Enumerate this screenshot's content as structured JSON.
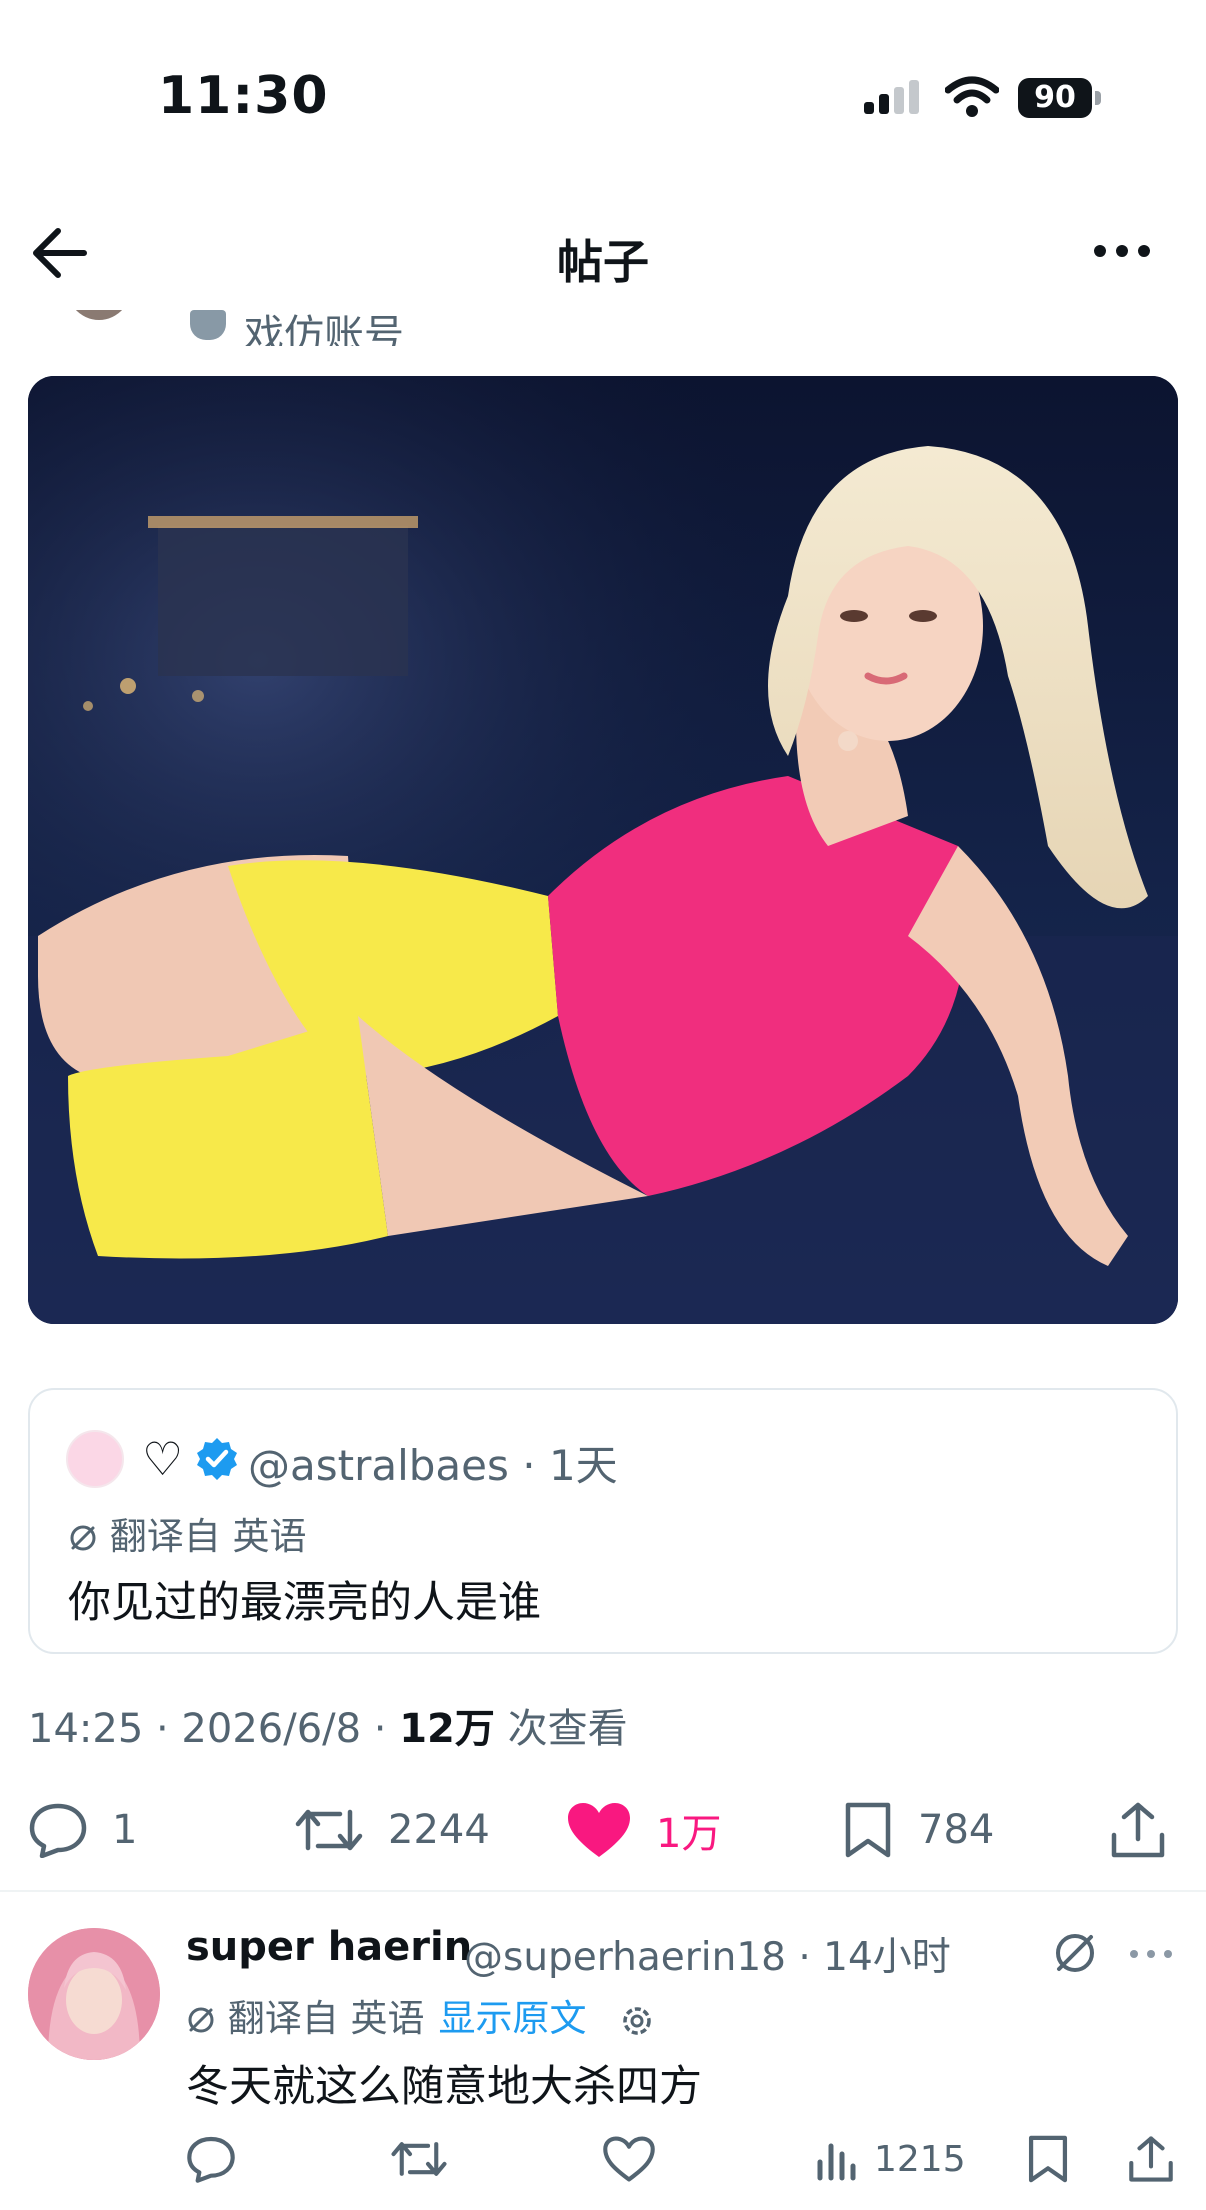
{
  "status_bar": {
    "time": "11:30",
    "battery": "90"
  },
  "header": {
    "title": "帖子"
  },
  "previous_row": {
    "label": "戏仿账号"
  },
  "quoted_post": {
    "name_emoji": "♡",
    "handle": "@astralbaes",
    "time": "1天",
    "translated_label": "翻译自 英语",
    "text": "你见过的最漂亮的人是谁"
  },
  "post_meta": {
    "timestamp": "14:25 · 2026/6/8 · ",
    "views_count": "12万",
    "views_label": " 次查看"
  },
  "post_actions": {
    "replies": "1",
    "reposts": "2244",
    "likes": "1万",
    "bookmarks": "784"
  },
  "reply": {
    "name": "super haerin",
    "handle": "@superhaerin18 · 14小时",
    "translated_label": "翻译自 英语",
    "show_original": "显示原文",
    "text": "冬天就这么随意地大杀四方",
    "views": "1215"
  },
  "colors": {
    "like": "#f91880",
    "link": "#1d9bf0",
    "verified": "#1d9bf0",
    "secondary": "#536471"
  }
}
